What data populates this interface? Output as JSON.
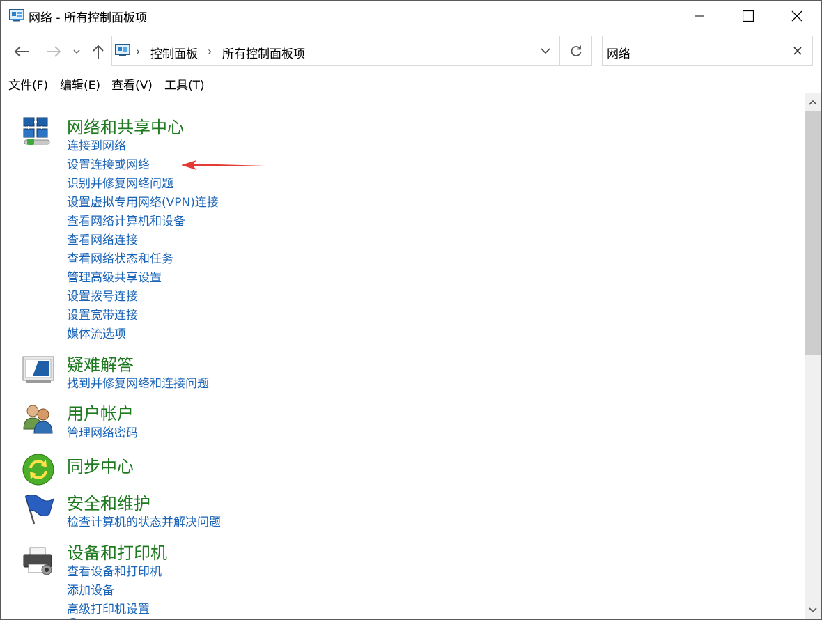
{
  "window": {
    "title": "网络 - 所有控制面板项",
    "title_icon": "control-panel-icon"
  },
  "address": {
    "crumbs": [
      "控制面板",
      "所有控制面板项"
    ],
    "search_value": "网络"
  },
  "menu": [
    "文件(F)",
    "编辑(E)",
    "查看(V)",
    "工具(T)"
  ],
  "sections": [
    {
      "title": "网络和共享中心",
      "icon": "network-sharing-icon",
      "links": [
        "连接到网络",
        "设置连接或网络",
        "识别并修复网络问题",
        "设置虚拟专用网络(VPN)连接",
        "查看网络计算机和设备",
        "查看网络连接",
        "查看网络状态和任务",
        "管理高级共享设置",
        "设置拨号连接",
        "设置宽带连接",
        "媒体流选项"
      ]
    },
    {
      "title": "疑难解答",
      "icon": "troubleshooting-icon",
      "links": [
        "找到并修复网络和连接问题"
      ]
    },
    {
      "title": "用户帐户",
      "icon": "user-accounts-icon",
      "links": [
        "管理网络密码"
      ]
    },
    {
      "title": "同步中心",
      "icon": "sync-center-icon",
      "links": []
    },
    {
      "title": "安全和维护",
      "icon": "security-flag-icon",
      "links": [
        "检查计算机的状态并解决问题"
      ]
    },
    {
      "title": "设备和打印机",
      "icon": "printer-icon",
      "links": [
        "查看设备和打印机",
        "添加设备",
        "高级打印机设置"
      ]
    }
  ],
  "colors": {
    "section_title": "#1e7a1e",
    "link": "#1a64b8",
    "annotation_arrow": "#e53935"
  }
}
